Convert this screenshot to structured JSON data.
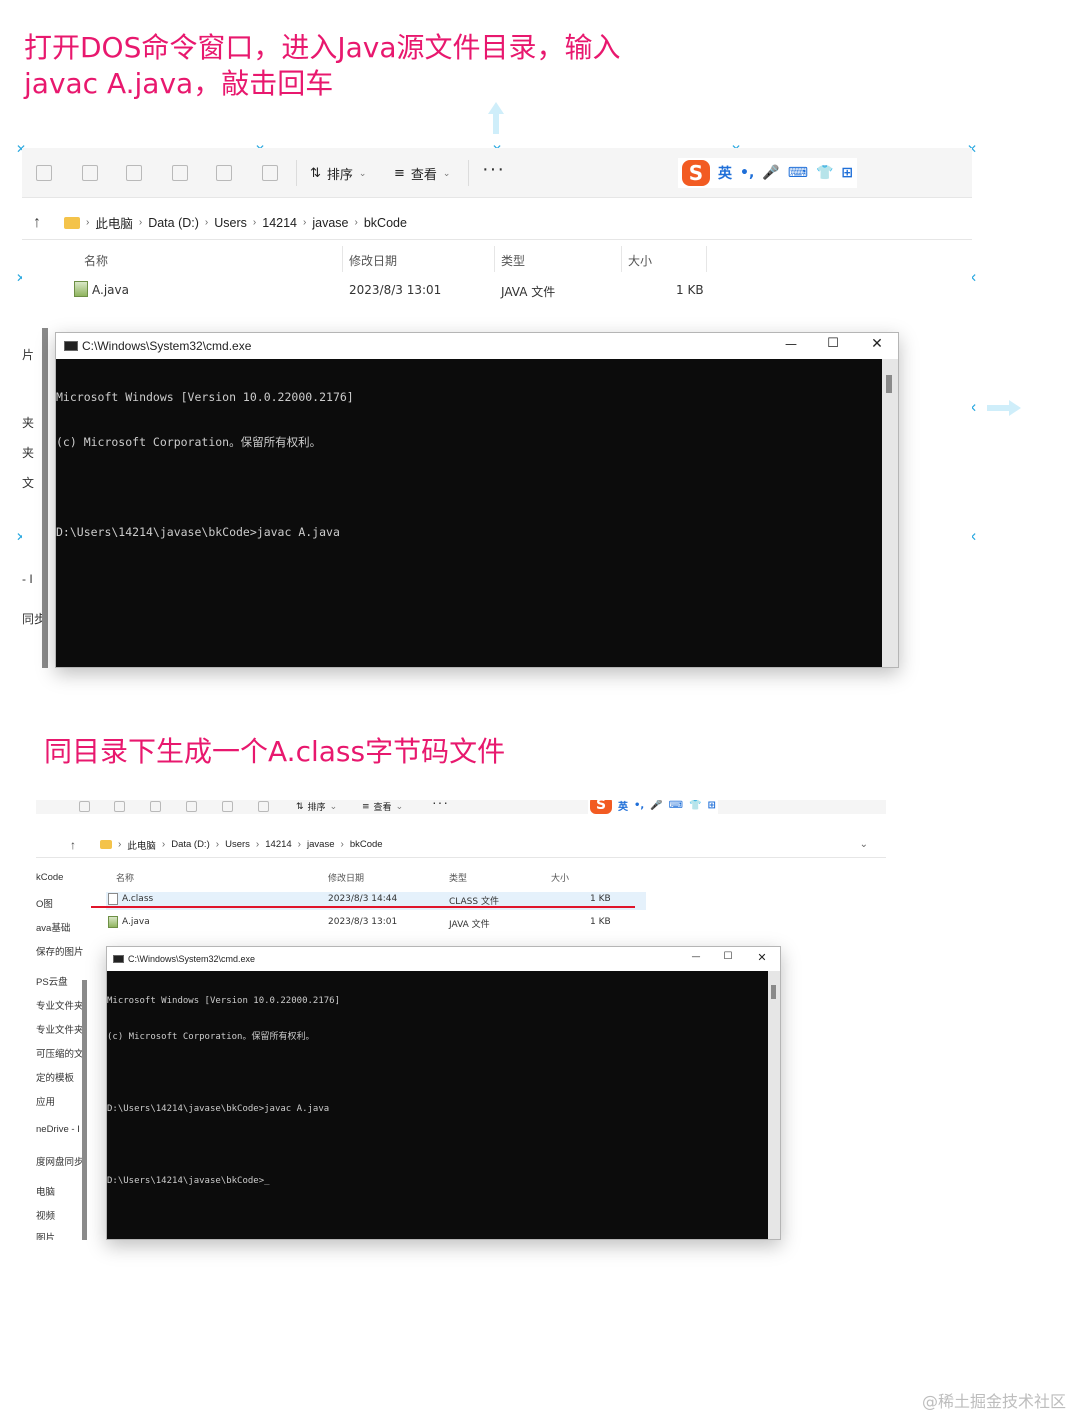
{
  "captions": {
    "top": "打开DOS命令窗口，进入Java源文件目录，输入javac A.java，敲击回车",
    "bottom": "同目录下生成一个A.class字节码文件"
  },
  "toolbar": {
    "sort_label": "排序",
    "view_label": "查看",
    "more_label": "···"
  },
  "ime": {
    "logo": "S",
    "lang": "英",
    "punct": "•,",
    "mic": "🎤",
    "keyboard": "⌨",
    "skin": "👕",
    "grid": "⊞"
  },
  "explorer1": {
    "path": [
      "此电脑",
      "Data (D:)",
      "Users",
      "14214",
      "javase",
      "bkCode"
    ],
    "columns": [
      "名称",
      "修改日期",
      "类型",
      "大小"
    ],
    "files": [
      {
        "name": "A.java",
        "date": "2023/8/3 13:01",
        "type": "JAVA 文件",
        "size": "1 KB"
      }
    ],
    "sidebar_fragments": [
      "片",
      "夹",
      "夹",
      "文",
      "- I",
      "同步"
    ]
  },
  "cmd1": {
    "title": "C:\\Windows\\System32\\cmd.exe",
    "minimize": "—",
    "maximize": "☐",
    "close": "✕",
    "lines": [
      "Microsoft Windows [Version 10.0.22000.2176]",
      "(c) Microsoft Corporation。保留所有权利。",
      "",
      "D:\\Users\\14214\\javase\\bkCode>javac A.java"
    ]
  },
  "explorer2": {
    "path": [
      "此电脑",
      "Data (D:)",
      "Users",
      "14214",
      "javase",
      "bkCode"
    ],
    "columns": [
      "名称",
      "修改日期",
      "类型",
      "大小"
    ],
    "files": [
      {
        "name": "A.class",
        "date": "2023/8/3 14:44",
        "type": "CLASS 文件",
        "size": "1 KB"
      },
      {
        "name": "A.java",
        "date": "2023/8/3 13:01",
        "type": "JAVA 文件",
        "size": "1 KB"
      }
    ],
    "sidebar_items": [
      "kCode",
      "O图",
      "ava基础",
      "保存的图片",
      "PS云盘",
      "专业文件夹",
      "专业文件夹",
      "可压缩的文",
      "定的模板",
      "应用",
      "neDrive - I",
      "度网盘同步",
      "电脑",
      "视频",
      "图片"
    ]
  },
  "cmd2": {
    "title": "C:\\Windows\\System32\\cmd.exe",
    "minimize": "—",
    "maximize": "☐",
    "close": "✕",
    "lines": [
      "Microsoft Windows [Version 10.0.22000.2176]",
      "(c) Microsoft Corporation。保留所有权利。",
      "",
      "D:\\Users\\14214\\javase\\bkCode>javac A.java",
      "",
      "D:\\Users\\14214\\javase\\bkCode>_"
    ]
  },
  "watermark": "@稀土掘金技术社区",
  "colors": {
    "caption": "#e8186e",
    "handle": "#29a8e0",
    "underline": "#e0142a",
    "console_bg": "#0c0c0c"
  }
}
